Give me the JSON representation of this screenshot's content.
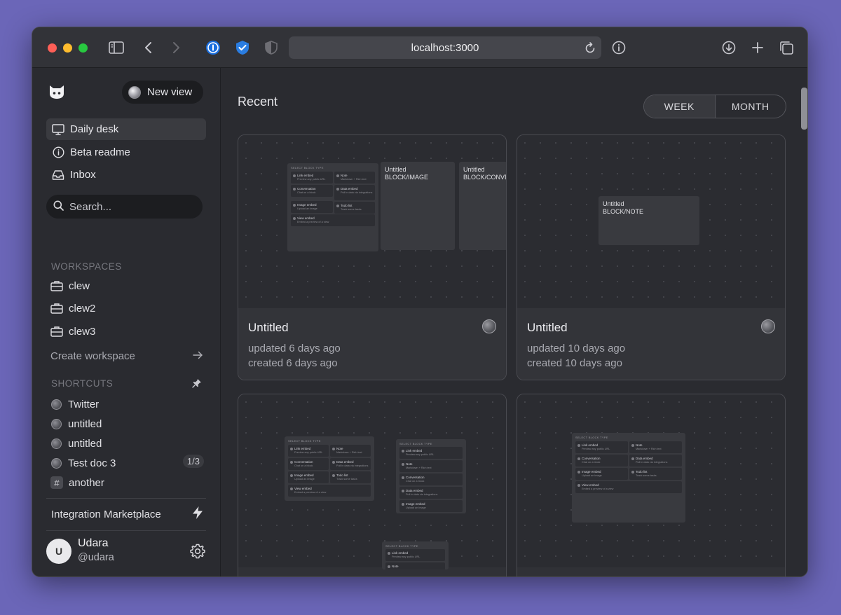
{
  "browser": {
    "url": "localhost:3000"
  },
  "sidebar": {
    "new_view_label": "New view",
    "nav": [
      {
        "label": "Daily desk",
        "icon": "monitor-icon"
      },
      {
        "label": "Beta readme",
        "icon": "info-icon"
      },
      {
        "label": "Inbox",
        "icon": "inbox-icon"
      }
    ],
    "search_placeholder": "Search...",
    "workspaces_label": "WORKSPACES",
    "workspaces": [
      {
        "label": "clew",
        "icon": "briefcase-icon"
      },
      {
        "label": "clew2",
        "icon": "briefcase-icon"
      },
      {
        "label": "clew3",
        "icon": "briefcase-icon"
      }
    ],
    "create_workspace_label": "Create workspace",
    "shortcuts_label": "SHORTCUTS",
    "shortcuts": [
      {
        "label": "Twitter",
        "icon": "orb-icon"
      },
      {
        "label": "untitled",
        "icon": "orb-icon"
      },
      {
        "label": "untitled",
        "icon": "orb-icon"
      },
      {
        "label": "Test doc 3",
        "icon": "orb-icon",
        "badge": "1/3"
      },
      {
        "label": "another",
        "icon": "hash-icon",
        "glyph": "#"
      }
    ],
    "integration_label": "Integration Marketplace",
    "user": {
      "initial": "U",
      "name": "Udara",
      "handle": "@udara"
    }
  },
  "main": {
    "title": "Recent",
    "toggle": [
      "WEEK",
      "MONTH"
    ],
    "cards": [
      {
        "title": "Untitled",
        "updated": "updated 6 days ago",
        "created": "created 6 days ago"
      },
      {
        "title": "Untitled",
        "updated": "updated 10 days ago",
        "created": "created 10 days ago"
      }
    ],
    "preview": {
      "select_header": "SELECT BLOCK TYPE",
      "block_image": [
        "Untitled",
        "BLOCK/IMAGE"
      ],
      "block_conve": [
        "Untitled",
        "BLOCK/CONVE"
      ],
      "block_note": [
        "Untitled",
        "BLOCK/NOTE"
      ],
      "rows": [
        {
          "t": "Link embed",
          "s": "Preview any public URL"
        },
        {
          "t": "Note",
          "s": "Markdown + Rich text"
        },
        {
          "t": "Conversation",
          "s": "Chat on a block"
        },
        {
          "t": "Data embed",
          "s": "Pull in data via integrations"
        },
        {
          "t": "Image embed",
          "s": "Upload an image"
        },
        {
          "t": "Todo list",
          "s": "Track some tasks"
        },
        {
          "t": "View embed",
          "s": "Embed a preview of a view"
        }
      ]
    }
  }
}
